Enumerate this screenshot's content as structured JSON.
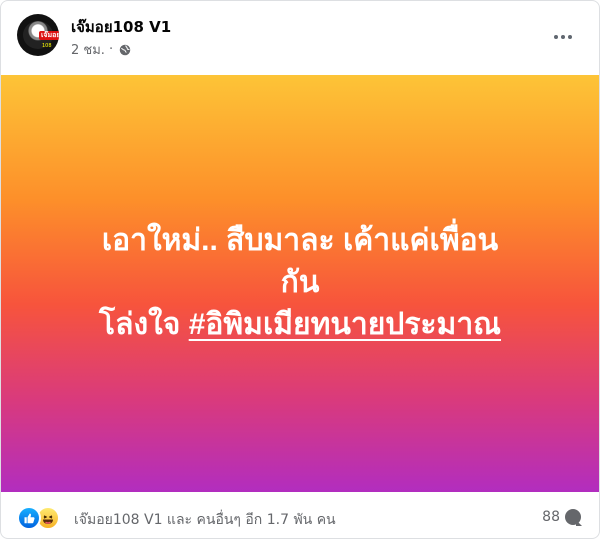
{
  "post": {
    "author": "เจ๊มอย108 V1",
    "time": "2 ชม.",
    "separator": "·",
    "avatar_label": "เจ๊มอย",
    "avatar_sublabel": "108",
    "privacy_icon": "globe-icon",
    "more_icon": "ellipsis-icon"
  },
  "content": {
    "line1": "เอาใหม่.. สืบมาละ เค้าแค่เพื่อน",
    "line2": "กัน",
    "line3_prefix": "โล่งใจ ",
    "hashtag": "#อิพิมเมียทนายประมาณ",
    "gradient": [
      "#fdc437",
      "#fd8f2a",
      "#f7543c",
      "#d93a7d",
      "#b22dbf"
    ]
  },
  "footer": {
    "reaction_icons": [
      "like-icon",
      "haha-icon"
    ],
    "reaction_text": "เจ๊มอย108 V1 และ คนอื่นๆ อีก 1.7 พัน คน",
    "comment_count": "88"
  }
}
